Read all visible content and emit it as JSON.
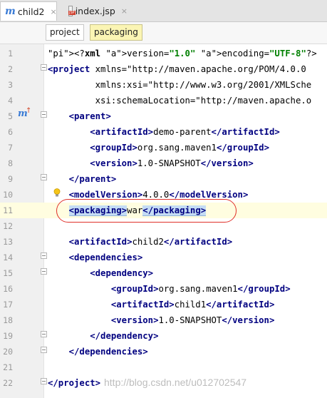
{
  "tabs": [
    {
      "icon": "maven-m-icon",
      "label": "child2",
      "active": true
    },
    {
      "icon": "jsp-file-icon",
      "label": "index.jsp",
      "active": false
    }
  ],
  "tab_close_glyph": "×",
  "breadcrumbs": [
    "project",
    "packaging"
  ],
  "lines": [
    {
      "n": "1",
      "text": "<?xml version=\"1.0\" encoding=\"UTF-8\"?>"
    },
    {
      "n": "2",
      "text": "<project xmlns=\"http://maven.apache.org/POM/4.0.0"
    },
    {
      "n": "3",
      "text": "         xmlns:xsi=\"http://www.w3.org/2001/XMLSche"
    },
    {
      "n": "4",
      "text": "         xsi:schemaLocation=\"http://maven.apache.o"
    },
    {
      "n": "5",
      "text": "    <parent>"
    },
    {
      "n": "6",
      "text": "        <artifactId>demo-parent</artifactId>"
    },
    {
      "n": "7",
      "text": "        <groupId>org.sang.maven1</groupId>"
    },
    {
      "n": "8",
      "text": "        <version>1.0-SNAPSHOT</version>"
    },
    {
      "n": "9",
      "text": "    </parent>"
    },
    {
      "n": "10",
      "text": "    <modelVersion>4.0.0</modelVersion>"
    },
    {
      "n": "11",
      "text": "    <packaging>war</packaging>"
    },
    {
      "n": "12",
      "text": ""
    },
    {
      "n": "13",
      "text": "    <artifactId>child2</artifactId>"
    },
    {
      "n": "14",
      "text": "    <dependencies>"
    },
    {
      "n": "15",
      "text": "        <dependency>"
    },
    {
      "n": "16",
      "text": "            <groupId>org.sang.maven1</groupId>"
    },
    {
      "n": "17",
      "text": "            <artifactId>child1</artifactId>"
    },
    {
      "n": "18",
      "text": "            <version>1.0-SNAPSHOT</version>"
    },
    {
      "n": "19",
      "text": "        </dependency>"
    },
    {
      "n": "20",
      "text": "    </dependencies>"
    },
    {
      "n": "21",
      "text": ""
    },
    {
      "n": "22",
      "text": "</project>"
    }
  ],
  "watermark": "http://blog.csdn.net/u012702547",
  "colors": {
    "tag": "#000080",
    "attr": "#0000ff",
    "string": "#008000",
    "current_line": "#fffde0",
    "annotation": "#e0312a",
    "active_crumb": "#fbf5b4"
  },
  "icons": {
    "gutter_line_5": "maven-override-icon",
    "gutter_line_10": "intention-bulb-icon"
  }
}
